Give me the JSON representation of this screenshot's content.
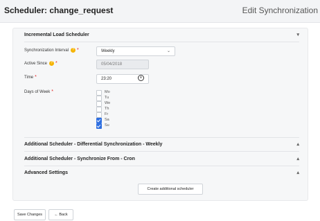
{
  "header": {
    "title": "Scheduler: change_request",
    "subtitle": "Edit Synchronization"
  },
  "incremental": {
    "title": "Incremental Load Scheduler",
    "caret": "▾",
    "sync_interval": {
      "label": "Synchronization Interval",
      "value": "Weekly",
      "chevron": "⌄"
    },
    "active_since": {
      "label": "Active Since",
      "value": "05/04/2018"
    },
    "time": {
      "label": "Time",
      "value": "23:20"
    },
    "days": {
      "label": "Days of Week",
      "items": [
        {
          "label": "Mo",
          "checked": false
        },
        {
          "label": "Tu",
          "checked": false
        },
        {
          "label": "We",
          "checked": false
        },
        {
          "label": "Th",
          "checked": false
        },
        {
          "label": "Fr",
          "checked": false
        },
        {
          "label": "Sa",
          "checked": true
        },
        {
          "label": "Su",
          "checked": true
        }
      ]
    },
    "required_mark": "*"
  },
  "sections": [
    {
      "title": "Additional Scheduler - Differential Synchronization - Weekly",
      "caret": "▴"
    },
    {
      "title": "Additional Scheduler - Synchronize From - Cron",
      "caret": "▴"
    },
    {
      "title": "Advanced Settings",
      "caret": "▴"
    }
  ],
  "buttons": {
    "create_additional": "Create additional scheduler",
    "save": "Save Changes",
    "back": "Back"
  },
  "colors": {
    "accent": "#2f6fe0",
    "info": "#f5b400",
    "required": "#e02020"
  }
}
